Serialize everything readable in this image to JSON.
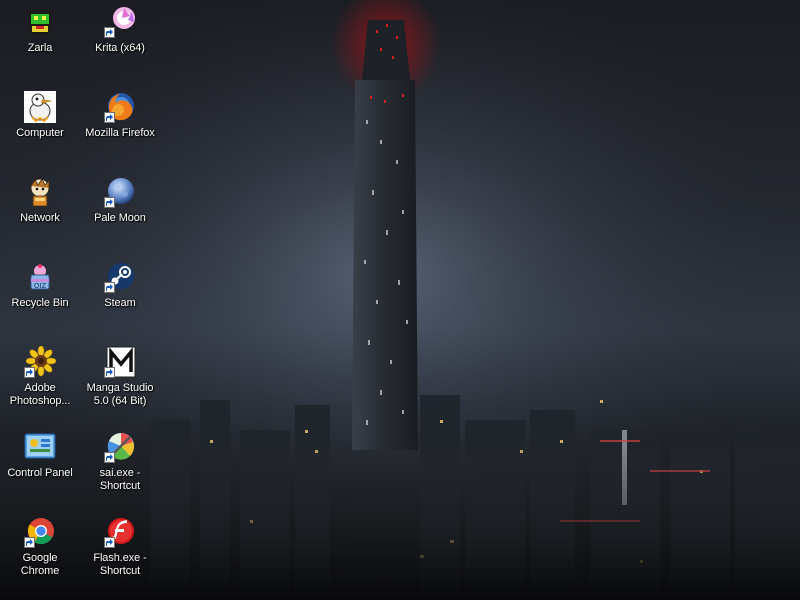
{
  "desktop": {
    "icons": [
      {
        "label": "Zarla",
        "icon": "zarla-icon",
        "shortcut": false
      },
      {
        "label": "Krita (x64)",
        "icon": "krita-icon",
        "shortcut": true
      },
      {
        "label": "Computer",
        "icon": "computer-duck-icon",
        "shortcut": false
      },
      {
        "label": "Mozilla Firefox",
        "icon": "firefox-icon",
        "shortcut": true
      },
      {
        "label": "Network",
        "icon": "network-character-icon",
        "shortcut": false
      },
      {
        "label": "Pale Moon",
        "icon": "pale-moon-icon",
        "shortcut": true
      },
      {
        "label": "Recycle Bin",
        "icon": "recycle-bin-cake-icon",
        "shortcut": false
      },
      {
        "label": "Steam",
        "icon": "steam-icon",
        "shortcut": true
      },
      {
        "label": "Adobe\nPhotoshop...",
        "icon": "photoshop-sunflower-icon",
        "shortcut": true
      },
      {
        "label": "Manga Studio\n5.0 (64 Bit)",
        "icon": "manga-studio-icon",
        "shortcut": true
      },
      {
        "label": "Control Panel",
        "icon": "control-panel-icon",
        "shortcut": false
      },
      {
        "label": "sai.exe -\nShortcut",
        "icon": "sai-icon",
        "shortcut": true
      },
      {
        "label": "Google Chrome",
        "icon": "chrome-icon",
        "shortcut": true
      },
      {
        "label": "Flash.exe -\nShortcut",
        "icon": "flash-icon",
        "shortcut": true
      }
    ]
  },
  "wallpaper": {
    "description_icon": "night-city-tower-wallpaper",
    "colors": {
      "sky_top": "#1b1e26",
      "sky_glow": "#5d6a80",
      "tower": "#2a2e36",
      "beacon": "#c01818",
      "city_lights": "#e8c070"
    }
  }
}
